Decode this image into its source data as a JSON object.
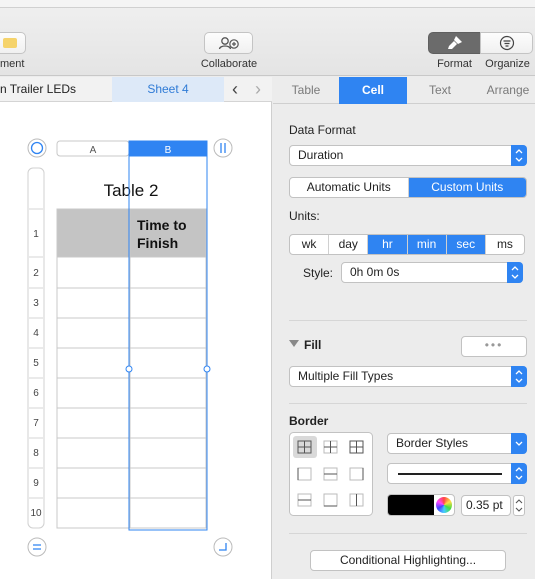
{
  "toolbar": {
    "left_partial_label": "ment",
    "collaborate_label": "Collaborate",
    "format_label": "Format",
    "organize_label": "Organize"
  },
  "sheets": {
    "tab1": "n Trailer LEDs",
    "tab2": "Sheet 4"
  },
  "table": {
    "title": "Table 2",
    "columns": [
      "A",
      "B"
    ],
    "header_cell": "Time to\nFinish",
    "row_numbers": [
      "1",
      "2",
      "3",
      "4",
      "5",
      "6",
      "7",
      "8",
      "9",
      "10"
    ]
  },
  "inspector": {
    "tabs": [
      "Table",
      "Cell",
      "Text",
      "Arrange"
    ],
    "active_tab": "Cell",
    "data_format_title": "Data Format",
    "data_format_value": "Duration",
    "units_mode": [
      "Automatic Units",
      "Custom Units"
    ],
    "units_mode_selected": "Custom Units",
    "units_title": "Units:",
    "units": [
      {
        "label": "wk",
        "on": false
      },
      {
        "label": "day",
        "on": false
      },
      {
        "label": "hr",
        "on": true
      },
      {
        "label": "min",
        "on": true
      },
      {
        "label": "sec",
        "on": true
      },
      {
        "label": "ms",
        "on": false
      }
    ],
    "style_label": "Style:",
    "style_value": "0h 0m 0s",
    "fill_title": "Fill",
    "fill_value": "Multiple Fill Types",
    "border_title": "Border",
    "border_styles_value": "Border Styles",
    "border_width_value": "0.35 pt",
    "conditional_button": "Conditional Highlighting..."
  },
  "colors": {
    "accent": "#2f84f2",
    "selection": "#2f84f2"
  }
}
